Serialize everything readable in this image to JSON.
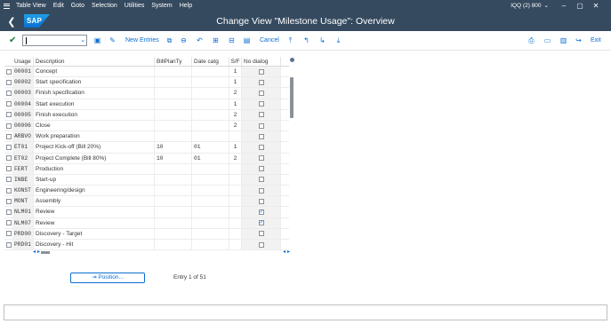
{
  "menubar": {
    "items": [
      "Table View",
      "Edit",
      "Goto",
      "Selection",
      "Utilities",
      "System",
      "Help"
    ],
    "system_info": "IQQ (2) 800"
  },
  "titlebar": {
    "logo_text": "SAP",
    "title": "Change View \"Milestone Usage\": Overview"
  },
  "toolbar": {
    "command_field_value": "",
    "new_entries_label": "New Entries",
    "cancel_label": "Cancel",
    "exit_label": "Exit"
  },
  "table": {
    "columns": [
      "Usage",
      "Description",
      "BillPlanTy",
      "Date catg",
      "S/F",
      "No dialog"
    ],
    "rows": [
      {
        "usage": "00001",
        "description": "Concept",
        "billplanty": "",
        "date_catg": "",
        "sf": "1",
        "no_dialog": false
      },
      {
        "usage": "00002",
        "description": "Start specification",
        "billplanty": "",
        "date_catg": "",
        "sf": "1",
        "no_dialog": false
      },
      {
        "usage": "00003",
        "description": "Finish specification",
        "billplanty": "",
        "date_catg": "",
        "sf": "2",
        "no_dialog": false
      },
      {
        "usage": "00004",
        "description": "Start execution",
        "billplanty": "",
        "date_catg": "",
        "sf": "1",
        "no_dialog": false
      },
      {
        "usage": "00005",
        "description": "Finish execution",
        "billplanty": "",
        "date_catg": "",
        "sf": "2",
        "no_dialog": false
      },
      {
        "usage": "00006",
        "description": "Close",
        "billplanty": "",
        "date_catg": "",
        "sf": "2",
        "no_dialog": false
      },
      {
        "usage": "ARBVO",
        "description": "Work preparation",
        "billplanty": "",
        "date_catg": "",
        "sf": "",
        "no_dialog": false
      },
      {
        "usage": "ET01",
        "description": "Project Kick-off (Bill 20%)",
        "billplanty": "10",
        "date_catg": "01",
        "sf": "1",
        "no_dialog": false
      },
      {
        "usage": "ET02",
        "description": "Project Complete (Bill 80%)",
        "billplanty": "10",
        "date_catg": "01",
        "sf": "2",
        "no_dialog": false
      },
      {
        "usage": "FERT",
        "description": "Production",
        "billplanty": "",
        "date_catg": "",
        "sf": "",
        "no_dialog": false
      },
      {
        "usage": "INBE",
        "description": "Start-up",
        "billplanty": "",
        "date_catg": "",
        "sf": "",
        "no_dialog": false
      },
      {
        "usage": "KONST",
        "description": "Engineering/design",
        "billplanty": "",
        "date_catg": "",
        "sf": "",
        "no_dialog": false
      },
      {
        "usage": "MONT",
        "description": "Assembly",
        "billplanty": "",
        "date_catg": "",
        "sf": "",
        "no_dialog": false
      },
      {
        "usage": "NLM01",
        "description": "Review",
        "billplanty": "",
        "date_catg": "",
        "sf": "",
        "no_dialog": true
      },
      {
        "usage": "NLM07",
        "description": "Review",
        "billplanty": "",
        "date_catg": "",
        "sf": "",
        "no_dialog": true
      },
      {
        "usage": "PRD00",
        "description": "Discovery - Target",
        "billplanty": "",
        "date_catg": "",
        "sf": "",
        "no_dialog": false
      },
      {
        "usage": "PRD01",
        "description": "Discovery - Hit",
        "billplanty": "",
        "date_catg": "",
        "sf": "",
        "no_dialog": false
      }
    ]
  },
  "position_button_label": "Position...",
  "entry_info": "Entry 1 of 51",
  "colors": {
    "shell": "#354a5f",
    "accent": "#0a6ed1",
    "check": "#107e3e"
  },
  "icons": {
    "menu": "hamburger-icon",
    "back": "back-icon",
    "enter": "check-icon"
  }
}
